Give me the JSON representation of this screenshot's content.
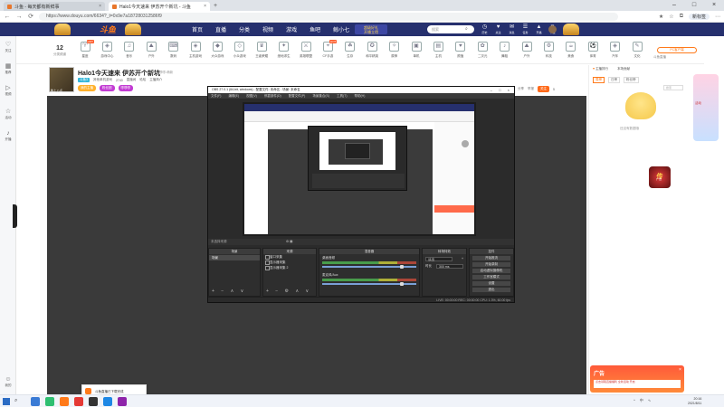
{
  "browser": {
    "tabs": [
      {
        "title": "斗鱼 - 每天都有新鲜事",
        "active": false
      },
      {
        "title": "Halo1今天速来 伊苏开个新坑 - 斗鱼",
        "active": true
      }
    ],
    "url": "https://www.douyu.com/6634?_t=0x9e7a187280312586f9",
    "user_button": "新标签",
    "new_tab": "+"
  },
  "site": {
    "logo": "斗鱼",
    "nav": [
      "首页",
      "直播",
      "分类",
      "视频",
      "游戏",
      "鱼吧",
      "鲸小七"
    ],
    "promo_top": "超级好礼",
    "promo_bottom": "开播立得",
    "search_placeholder": "搜索",
    "header_icons": [
      {
        "icon": "history-icon",
        "label": "历史"
      },
      {
        "icon": "follow-icon",
        "label": "关注"
      },
      {
        "icon": "message-icon",
        "label": "消息"
      },
      {
        "icon": "task-icon",
        "label": "任务"
      },
      {
        "icon": "upload-icon",
        "label": "开播"
      },
      {
        "icon": "download-icon",
        "label": "下载"
      }
    ]
  },
  "sidebar": [
    {
      "icon": "heart-icon",
      "label": "关注"
    },
    {
      "icon": "grid-icon",
      "label": "推荐"
    },
    {
      "icon": "play-icon",
      "label": "视频"
    },
    {
      "icon": "star-icon",
      "label": "活动"
    },
    {
      "icon": "mic-icon",
      "label": "开播"
    },
    {
      "icon": "user-icon",
      "label": "我的"
    }
  ],
  "categories": {
    "count": "12",
    "count_label": "分类频道",
    "items": [
      "星座",
      "游戏中心",
      "音乐",
      "户外",
      "数码",
      "主机游戏",
      "大众游戏",
      "小众游戏",
      "王者荣耀",
      "绝地求生",
      "英雄联盟",
      "CF手游",
      "生存",
      "和平精英",
      "原神",
      "单机",
      "主机",
      "颜值",
      "二次元",
      "舞蹈",
      "户外",
      "科技",
      "美食",
      "体育",
      "汽车",
      "文化"
    ],
    "pc_client": "PC客户端",
    "small_text": "斗鱼直播"
  },
  "stream": {
    "title": "Halo1今天速来 伊苏开个新坑",
    "tag1": "单机",
    "tag2": "哆哆-萌新",
    "avatar_caption": "晚上 八点",
    "category_chip": "斗鱼3",
    "row2": [
      "其他单机游戏",
      "2740",
      "直播间",
      "哈哈",
      "主播简介"
    ],
    "pills": [
      "我的主播",
      "粉丝团",
      "哆哆哆"
    ],
    "announcement": "直播间公告：欢迎你",
    "share": "分享",
    "report": "举报",
    "follow": "关注",
    "follow_count": "5"
  },
  "obs": {
    "title": "OBS 27.0.1 (64-bit, windows) - 配置文件: 未命名 - 场景: 未命名",
    "menu": [
      "文件(F)",
      "编辑(E)",
      "视图(V)",
      "停靠部件(D)",
      "配置文件(P)",
      "场景集合(S)",
      "工具(T)",
      "帮助(H)"
    ],
    "preview_label": "未选择来源",
    "docks": {
      "scenes": {
        "title": "场景",
        "items": [
          "场景"
        ]
      },
      "sources": {
        "title": "来源",
        "items": [
          "窗口采集",
          "显示器采集",
          "显示器采集 2"
        ]
      },
      "mixer": {
        "title": "混音器",
        "channels": [
          "桌面音频",
          "麦克风/Aux"
        ]
      },
      "transitions": {
        "title": "转场特效",
        "type": "淡出",
        "duration_label": "时长",
        "duration": "300 ms"
      },
      "controls": {
        "title": "控件",
        "buttons": [
          "开始推流",
          "开始录制",
          "启动虚拟摄像机",
          "工作室模式",
          "设置",
          "退出"
        ]
      }
    },
    "status": "LIVE: 00:00:00   REC: 00:00:00   CPU: 1.3%, 60.00 fps"
  },
  "right_panel": {
    "tabs": [
      "主播排行",
      "本场贡献"
    ],
    "sub_tabs": [
      "周榜",
      "日榜",
      "粉丝榜"
    ],
    "search": "搜索",
    "empty_text": "还没有数据哦",
    "ad_label": "广告"
  },
  "floating": {
    "right_caption": "活动"
  },
  "bottom_ad": {
    "label": "广告",
    "text": "点击领取直播福利 全新活动 开启",
    "close": "×"
  },
  "notify": {
    "text": "斗鱼直播已下载完成"
  },
  "taskbar": {
    "time": "20:16",
    "date": "2021/8/11",
    "tray": [
      "^",
      "中",
      "∿"
    ]
  }
}
